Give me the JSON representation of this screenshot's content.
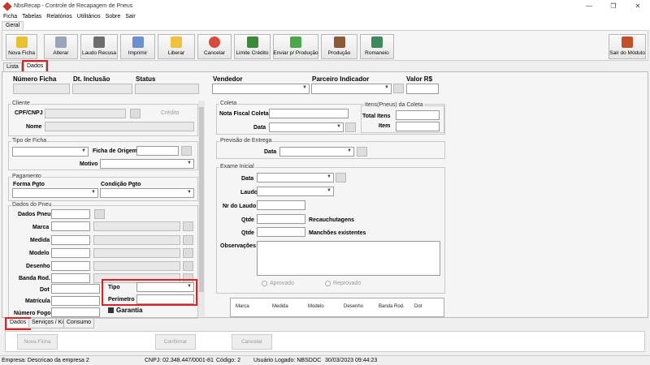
{
  "window": {
    "title": "NbsRecap - Controle de Recapagem de Pneus",
    "controls": [
      "—",
      "❐",
      "✕"
    ]
  },
  "menu": [
    "Ficha",
    "Tabelas",
    "Relatórios",
    "Utilitários",
    "Sobre",
    "Sair"
  ],
  "ribbon_tab": "Geral",
  "toolbar": [
    {
      "label": "Nova Ficha",
      "color": "#e8c030"
    },
    {
      "label": "Alterar",
      "color": "#9aa6b8"
    },
    {
      "label": "Laudo Recusa",
      "color": "#6d6d6d"
    },
    {
      "label": "Imprimir",
      "color": "#6b8fcf"
    },
    {
      "label": "Liberar",
      "color": "#f0c040"
    },
    {
      "label": "Cancelar",
      "color": "#d94a3a"
    },
    {
      "label": "Limite Crédito",
      "color": "#3a8a3a"
    },
    {
      "label": "Enviar p/ Produção",
      "color": "#4aa84a"
    },
    {
      "label": "Produção",
      "color": "#8a5a3a"
    },
    {
      "label": "Romaneio",
      "color": "#3a8a5a"
    },
    {
      "label": "Sair do Módulo",
      "color": "#c0502a"
    }
  ],
  "page_tabs": {
    "lista": "Lista",
    "dados": "Dados"
  },
  "header": {
    "numero_ficha": "Número Ficha",
    "dt_inclusao": "Dt. Inclusão",
    "status": "Status",
    "vendedor": "Vendedor",
    "parceiro": "Parceiro Indicador",
    "valor": "Valor R$"
  },
  "cliente": {
    "caption": "Cliente",
    "cpf": "CPF/CNPJ",
    "credito": "Crédito",
    "nome": "Nome"
  },
  "tipo_ficha": {
    "caption": "Tipo de Ficha",
    "origem": "Ficha de Origem",
    "motivo": "Motivo"
  },
  "pagamento": {
    "caption": "Pagamento",
    "forma": "Forma Pgto",
    "condicao": "Condição Pgto"
  },
  "pneu": {
    "caption": "Dados do Pneu",
    "dados": "Dados Pneu",
    "marca": "Marca",
    "medida": "Medida",
    "modelo": "Modelo",
    "desenho": "Desenho",
    "banda": "Banda Rod.",
    "dot": "Dot",
    "tipo": "Tipo",
    "matricula": "Matrícula",
    "perimetro": "Perímetro",
    "numero_fogo": "Número Fogo",
    "garantia": "Garantia"
  },
  "coleta": {
    "caption": "Coleta",
    "nota": "Nota Fiscal Coleta",
    "data": "Data",
    "itens_caption": "Itens(Pneus) da Coleta",
    "total": "Total Itens",
    "item": "Item"
  },
  "previsao": {
    "caption": "Previsão de Entrega",
    "data": "Data"
  },
  "exame": {
    "caption": "Exame Inicial",
    "data": "Data",
    "laudo": "Laudo",
    "nr_laudo": "Nr do Laudo",
    "qtde": "Qtde",
    "recauchutagens": "Recauchutagens",
    "qtde2": "Qtde",
    "manchoes": "Manchões existentes",
    "obs": "Observações",
    "aprovado": "Aprovado",
    "reprovado": "Reprovado"
  },
  "grid_cols": [
    "Marca",
    "Medida",
    "Modelo",
    "Desenho",
    "Banda Rod.",
    "Dot"
  ],
  "bottom_tabs": {
    "dados": "Dados",
    "servicos": "Serviços / Kit",
    "consumo": "Consumo"
  },
  "actions": {
    "nova": "Nova Ficha",
    "confirmar": "Confirmar",
    "cancelar": "Cancelar"
  },
  "status": {
    "empresa": "Empresa: Descricao da empresa 2",
    "cnpj": "CNPJ: 02.348.447/0001-81",
    "codigo": "Código: 2",
    "usuario": "Usuário Logado: NBSDOC",
    "datahora": "30/03/2023 09:44:23"
  }
}
